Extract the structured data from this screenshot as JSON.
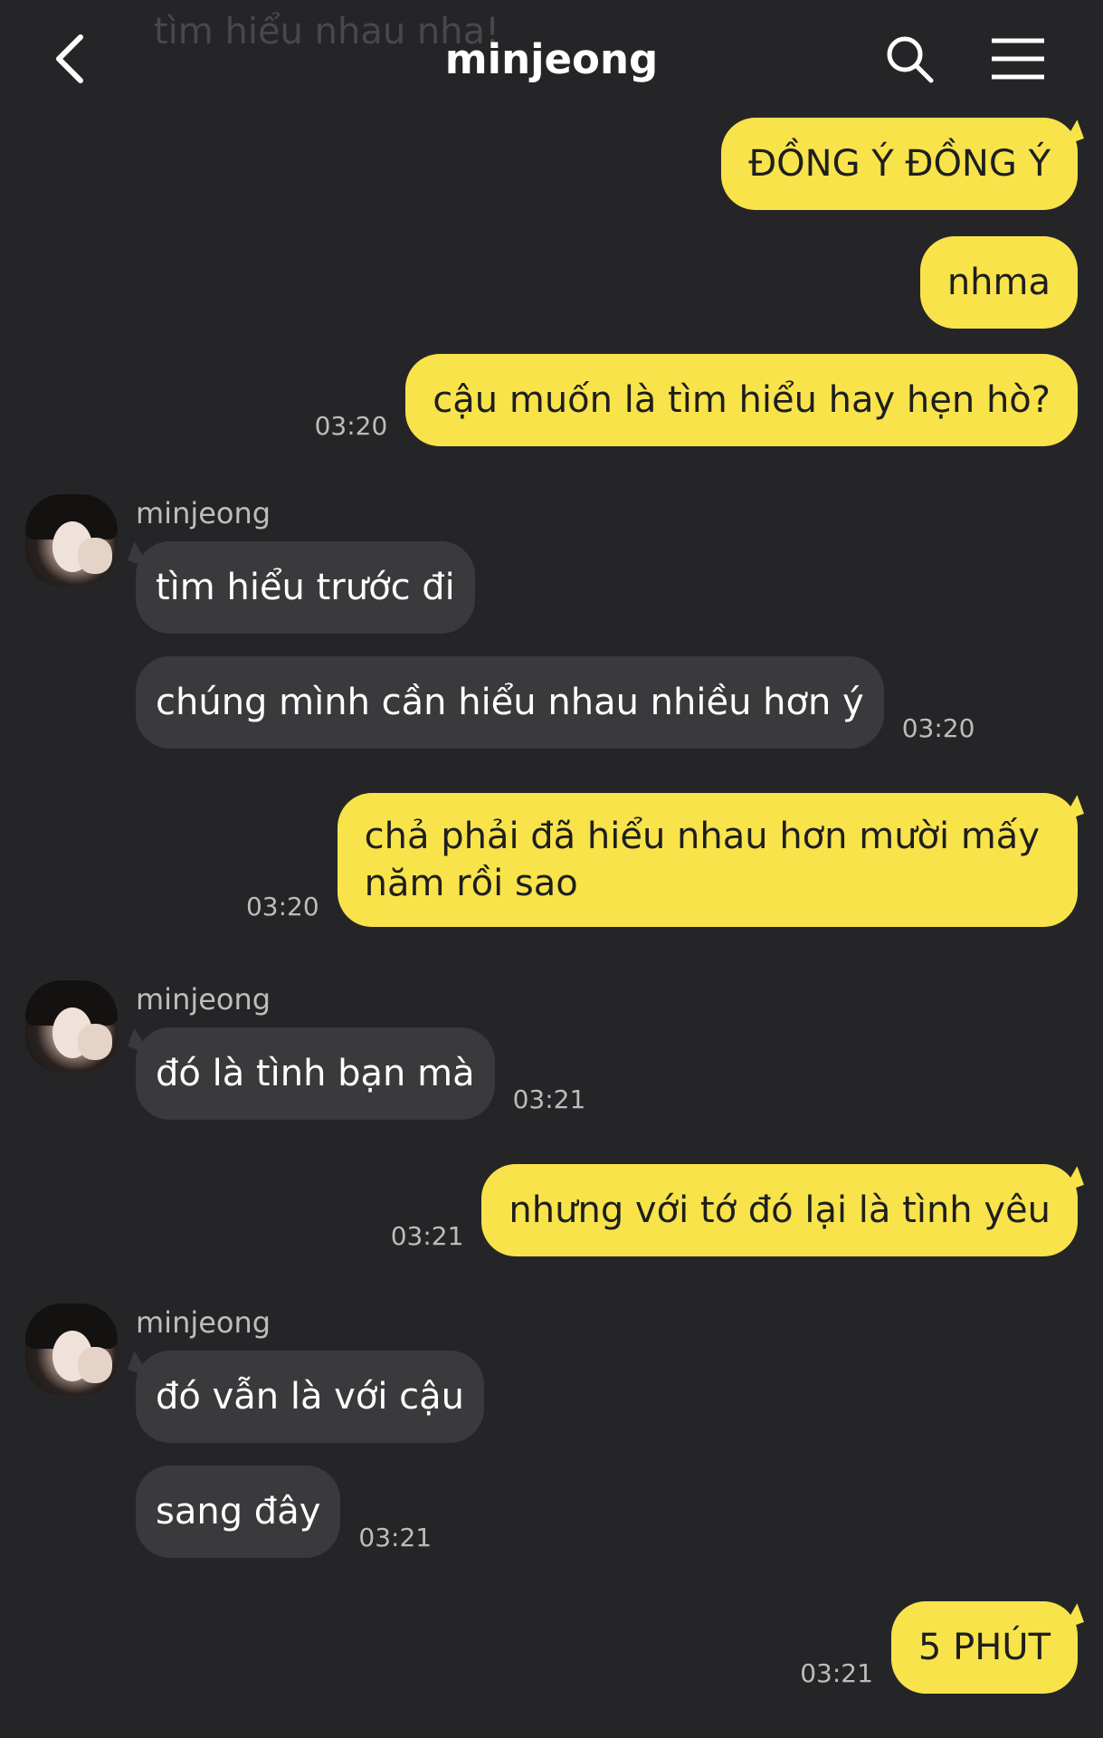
{
  "header": {
    "ghost_text": "tìm hiểu nhau nha!",
    "title": "minjeong"
  },
  "icons": {
    "back": "chevron-left-icon",
    "search": "search-icon",
    "menu": "hamburger-menu-icon"
  },
  "colors": {
    "background": "#252528",
    "my_bubble": "#f8e34a",
    "their_bubble": "#3a3a3d"
  },
  "messages": {
    "m1": {
      "text": "ĐỒNG Ý ĐỒNG Ý"
    },
    "m2": {
      "text": "nhma"
    },
    "m3": {
      "text": "cậu muốn là tìm hiểu hay hẹn hò?",
      "time": "03:20"
    },
    "g1": {
      "sender": "minjeong"
    },
    "m4": {
      "text": "tìm hiểu trước đi"
    },
    "m5": {
      "text": "chúng mình cần hiểu nhau nhiều hơn ý",
      "time": "03:20"
    },
    "m6": {
      "line1": "chả phải đã hiểu nhau hơn mười mấy",
      "line2": "năm rồi sao",
      "time": "03:20"
    },
    "g2": {
      "sender": "minjeong"
    },
    "m7": {
      "text": "đó là tình bạn mà",
      "time": "03:21"
    },
    "m8": {
      "text": "nhưng với tớ đó lại là tình yêu",
      "time": "03:21"
    },
    "g3": {
      "sender": "minjeong"
    },
    "m9": {
      "text": "đó vẫn là với cậu"
    },
    "m10": {
      "text": "sang đây",
      "time": "03:21"
    },
    "m11": {
      "text": "5 PHÚT",
      "time": "03:21"
    }
  }
}
